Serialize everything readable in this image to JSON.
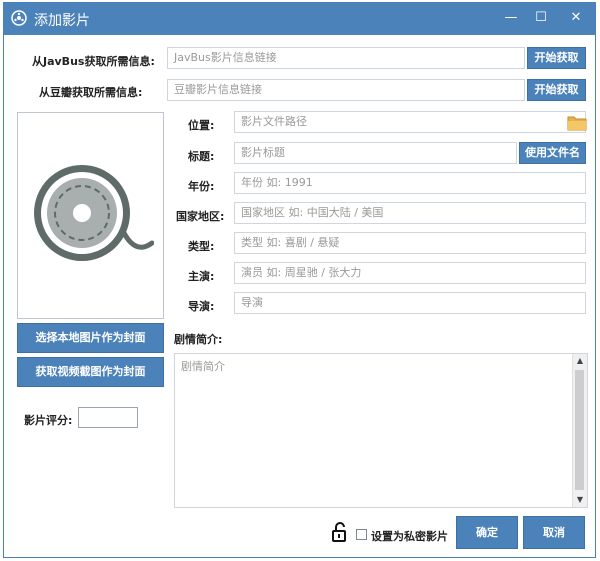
{
  "window": {
    "title": "添加影片",
    "min_glyph": "—",
    "max_glyph": "☐",
    "close_glyph": "✕"
  },
  "javbus": {
    "label": "从JavBus获取所需信息:",
    "placeholder": "JavBus影片信息链接",
    "button": "开始获取"
  },
  "douban": {
    "label": "从豆瓣获取所需信息:",
    "placeholder": "豆瓣影片信息链接",
    "button": "开始获取"
  },
  "fields": {
    "location": {
      "label": "位置:",
      "placeholder": "影片文件路径"
    },
    "title": {
      "label": "标题:",
      "placeholder": "影片标题",
      "button": "使用文件名"
    },
    "year": {
      "label": "年份:",
      "placeholder": "年份 如: 1991"
    },
    "region": {
      "label": "国家地区:",
      "placeholder": "国家地区 如: 中国大陆 / 美国"
    },
    "genre": {
      "label": "类型:",
      "placeholder": "类型 如: 喜剧 / 悬疑"
    },
    "cast": {
      "label": "主演:",
      "placeholder": "演员 如: 周星驰 / 张大力"
    },
    "director": {
      "label": "导演:",
      "placeholder": "导演"
    }
  },
  "poster": {
    "local_button": "选择本地图片作为封面",
    "video_button": "获取视频截图作为封面"
  },
  "rating": {
    "label": "影片评分:"
  },
  "synopsis": {
    "label": "剧情简介:",
    "placeholder": "剧情简介"
  },
  "footer": {
    "private_label": "设置为私密影片",
    "ok_button": "确定",
    "cancel_button": "取消"
  },
  "colors": {
    "accent": "#4a82b9",
    "film_icon": "#5f6b69"
  }
}
